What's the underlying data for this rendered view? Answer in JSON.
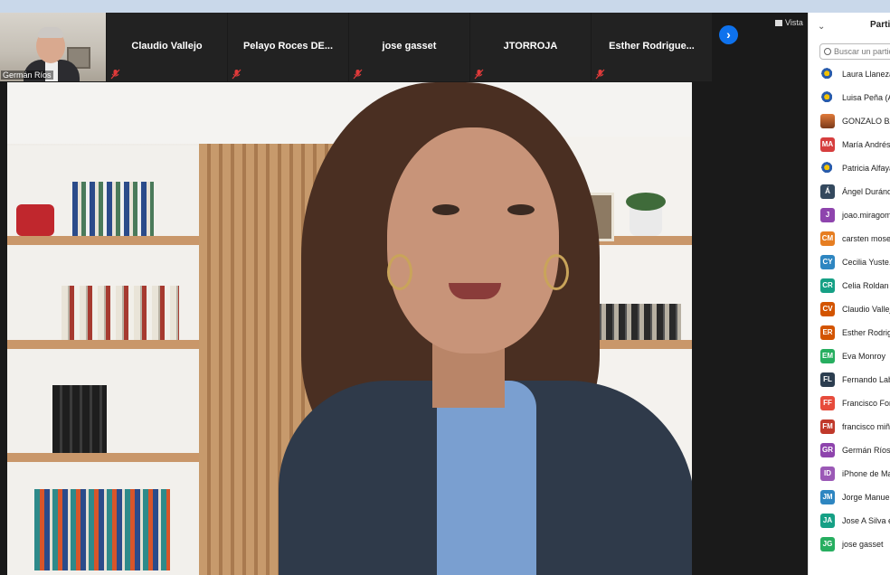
{
  "gallery": {
    "self_name": "Germán Ríos",
    "tiles": [
      {
        "name": "Claudio Vallejo"
      },
      {
        "name": "Pelayo Roces DE..."
      },
      {
        "name": "jose gasset"
      },
      {
        "name": "JTORROJA"
      },
      {
        "name": "Esther Rodrigue..."
      }
    ],
    "next_icon": "›",
    "view_label": "Vista"
  },
  "panel": {
    "title": "Partic",
    "search_placeholder": "Buscar un partic",
    "participants": [
      {
        "initials": "",
        "name": "Laura Llaneza (",
        "color": "#ffffff",
        "image": true
      },
      {
        "initials": "",
        "name": "Luisa Peña (Ar",
        "color": "#ffffff",
        "image": true
      },
      {
        "initials": "",
        "name": "GONZALO BAB",
        "color": "#b4652d",
        "image": true
      },
      {
        "initials": "MA",
        "name": "María Andrés",
        "color": "#d63e3e"
      },
      {
        "initials": "",
        "name": "Patricia Alfayat",
        "color": "#ffffff",
        "image": true
      },
      {
        "initials": "Á",
        "name": "Ángel Duránde",
        "color": "#34495e"
      },
      {
        "initials": "J",
        "name": "joao.miragome",
        "color": "#8e44ad"
      },
      {
        "initials": "CM",
        "name": "carsten moser",
        "color": "#e67e22"
      },
      {
        "initials": "CY",
        "name": "Cecilia Yuste. S",
        "color": "#2e86c1"
      },
      {
        "initials": "CR",
        "name": "Celia Roldan S",
        "color": "#16a085"
      },
      {
        "initials": "CV",
        "name": "Claudio Vallejo",
        "color": "#d35400"
      },
      {
        "initials": "ER",
        "name": "Esther Rodrigu",
        "color": "#d35400"
      },
      {
        "initials": "EM",
        "name": "Eva Monroy",
        "color": "#27ae60"
      },
      {
        "initials": "FL",
        "name": "Fernando Lab",
        "color": "#2c3e50"
      },
      {
        "initials": "FF",
        "name": "Francisco Fons",
        "color": "#e74c3c"
      },
      {
        "initials": "FM",
        "name": "francisco miña",
        "color": "#c0392b"
      },
      {
        "initials": "GR",
        "name": "Germán Ríos",
        "color": "#8e44ad"
      },
      {
        "initials": "ID",
        "name": "iPhone de Mar",
        "color": "#9b59b6"
      },
      {
        "initials": "JM",
        "name": "Jorge Manuel",
        "color": "#2e86c1"
      },
      {
        "initials": "JA",
        "name": "Jose A Silva e S",
        "color": "#16a085"
      },
      {
        "initials": "JG",
        "name": "jose gasset",
        "color": "#27ae60"
      }
    ]
  }
}
